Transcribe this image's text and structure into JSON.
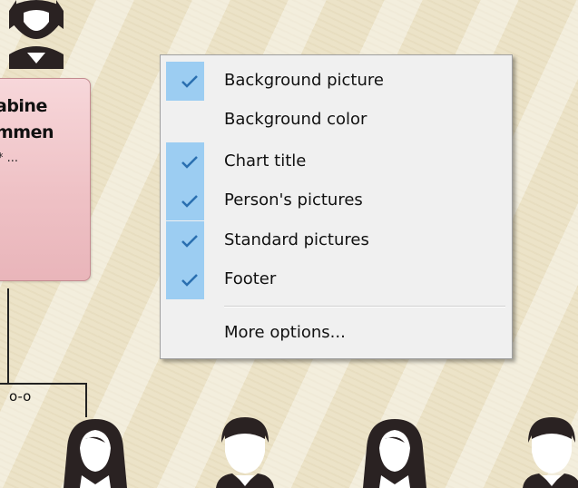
{
  "org_chart": {
    "person_card": {
      "name_line1": "abine",
      "name_line2": "mmen",
      "dates": "* ..."
    },
    "marriage_label": "o-o",
    "colors": {
      "card_fill": "#efc2c6",
      "card_border": "#c48c91",
      "line": "#222222"
    }
  },
  "context_menu": {
    "items": [
      {
        "label": "Background picture",
        "checked": true
      },
      {
        "label": "Background color",
        "checked": false
      },
      {
        "label": "Chart title",
        "checked": true
      },
      {
        "label": "Person's pictures",
        "checked": true
      },
      {
        "label": "Standard pictures",
        "checked": true
      },
      {
        "label": "Footer",
        "checked": true
      },
      {
        "label": "More options...",
        "checked": false
      }
    ],
    "colors": {
      "check_strip": "#9ccdf2",
      "check_mark": "#2a6fb0",
      "menu_bg": "#f0f0f0"
    }
  },
  "icons": {
    "check": "check-icon",
    "female_avatar": "female-avatar-icon",
    "male_avatar": "male-avatar-icon"
  }
}
